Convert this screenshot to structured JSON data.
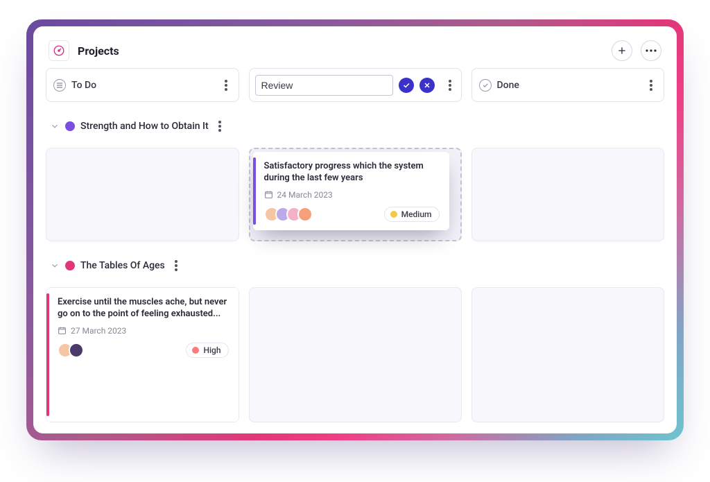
{
  "header": {
    "title": "Projects"
  },
  "columns": [
    {
      "id": "todo",
      "label": "To Do",
      "icon": "list",
      "editing": false
    },
    {
      "id": "review",
      "label": "Review",
      "icon": null,
      "editing": true
    },
    {
      "id": "done",
      "label": "Done",
      "icon": "check",
      "editing": false
    }
  ],
  "groups": [
    {
      "id": "g1",
      "title": "Strength and How to Obtain It",
      "color": "#7a4ee0",
      "cells": {
        "todo": {
          "empty": true
        },
        "review": {
          "drop": true,
          "card": {
            "title": "Satisfactory progress which the system during the last few years",
            "date": "24 March 2023",
            "accent": "#7a4ee0",
            "avatars": [
              "#f6c6a3",
              "#bda8e8",
              "#f4b0c7",
              "#f6a07a"
            ],
            "priority": {
              "label": "Medium",
              "color": "#f2c94c"
            }
          }
        },
        "done": {
          "empty": true
        }
      }
    },
    {
      "id": "g2",
      "title": "The Tables Of Ages",
      "color": "#e1377a",
      "cells": {
        "todo": {
          "card": {
            "title": "Exercise until the muscles ache, but never go on to the point of feeling exhausted...",
            "date": "27 March 2023",
            "accent": "#e1377a",
            "avatars": [
              "#f6c6a3",
              "#4a3a6a"
            ],
            "priority": {
              "label": "High",
              "color": "#ff7a7a"
            }
          }
        },
        "review": {
          "empty": true
        },
        "done": {
          "empty": true
        }
      }
    }
  ]
}
